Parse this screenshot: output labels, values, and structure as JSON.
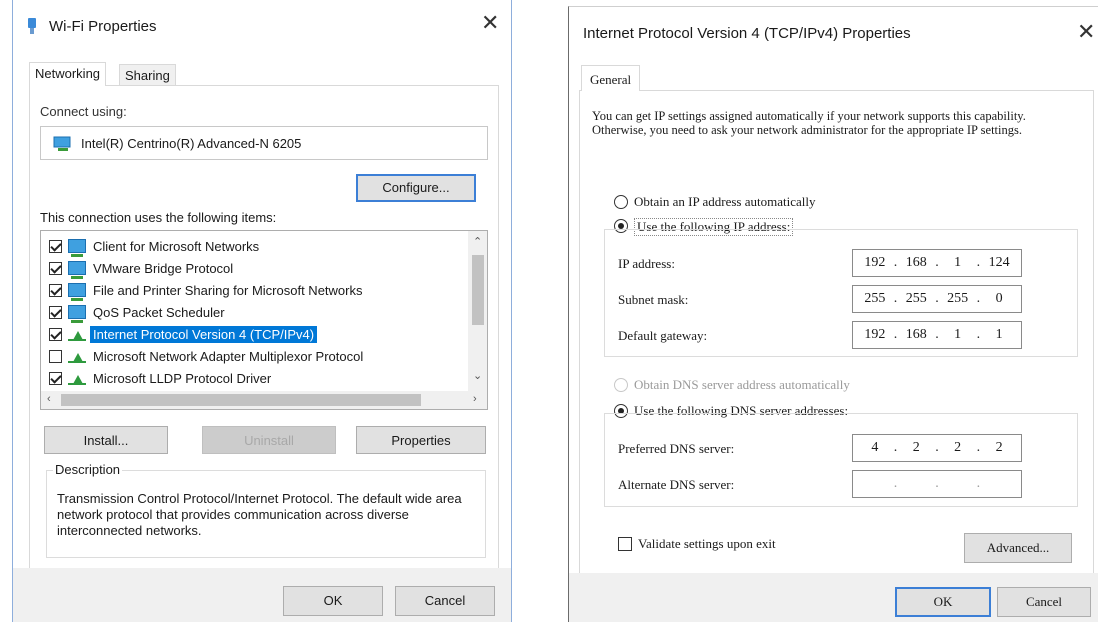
{
  "wifi": {
    "title": "Wi-Fi Properties",
    "close": "✕",
    "tabs": [
      "Networking",
      "Sharing"
    ],
    "connect_using_label": "Connect using:",
    "adapter": "Intel(R) Centrino(R) Advanced-N 6205",
    "configure_button": "Configure...",
    "items_label": "This connection uses the following items:",
    "items": [
      {
        "label": "Client for Microsoft Networks",
        "checked": true,
        "icon": "network-client-icon"
      },
      {
        "label": "VMware Bridge Protocol",
        "checked": true,
        "icon": "network-client-icon"
      },
      {
        "label": "File and Printer Sharing for Microsoft Networks",
        "checked": true,
        "icon": "network-client-icon"
      },
      {
        "label": "QoS Packet Scheduler",
        "checked": true,
        "icon": "network-client-icon"
      },
      {
        "label": "Internet Protocol Version 4 (TCP/IPv4)",
        "checked": true,
        "icon": "protocol-icon",
        "selected": true
      },
      {
        "label": "Microsoft Network Adapter Multiplexor Protocol",
        "checked": false,
        "icon": "protocol-icon"
      },
      {
        "label": "Microsoft LLDP Protocol Driver",
        "checked": true,
        "icon": "protocol-icon"
      }
    ],
    "install_button": "Install...",
    "uninstall_button": "Uninstall",
    "properties_button": "Properties",
    "description_label": "Description",
    "description_text": "Transmission Control Protocol/Internet Protocol. The default wide area network protocol that provides communication across diverse interconnected networks.",
    "ok_button": "OK",
    "cancel_button": "Cancel"
  },
  "ipv4": {
    "title": "Internet Protocol Version 4 (TCP/IPv4) Properties",
    "close": "✕",
    "tab": "General",
    "intro": "You can get IP settings assigned automatically if your network supports this capability. Otherwise, you need to ask your network administrator for the appropriate IP settings.",
    "obtain_ip_auto": "Obtain an IP address automatically",
    "use_following_ip": "Use the following IP address:",
    "ip_address_label": "IP address:",
    "ip_address": [
      "192",
      "168",
      "1",
      "124"
    ],
    "subnet_mask_label": "Subnet mask:",
    "subnet_mask": [
      "255",
      "255",
      "255",
      "0"
    ],
    "gateway_label": "Default gateway:",
    "gateway": [
      "192",
      "168",
      "1",
      "1"
    ],
    "obtain_dns_auto": "Obtain DNS server address automatically",
    "use_following_dns": "Use the following DNS server addresses:",
    "preferred_dns_label": "Preferred DNS server:",
    "preferred_dns": [
      "4",
      "2",
      "2",
      "2"
    ],
    "alternate_dns_label": "Alternate DNS server:",
    "alternate_dns": [
      "",
      "",
      "",
      ""
    ],
    "validate_label": "Validate settings upon exit",
    "advanced_button": "Advanced...",
    "ok_button": "OK",
    "cancel_button": "Cancel"
  }
}
